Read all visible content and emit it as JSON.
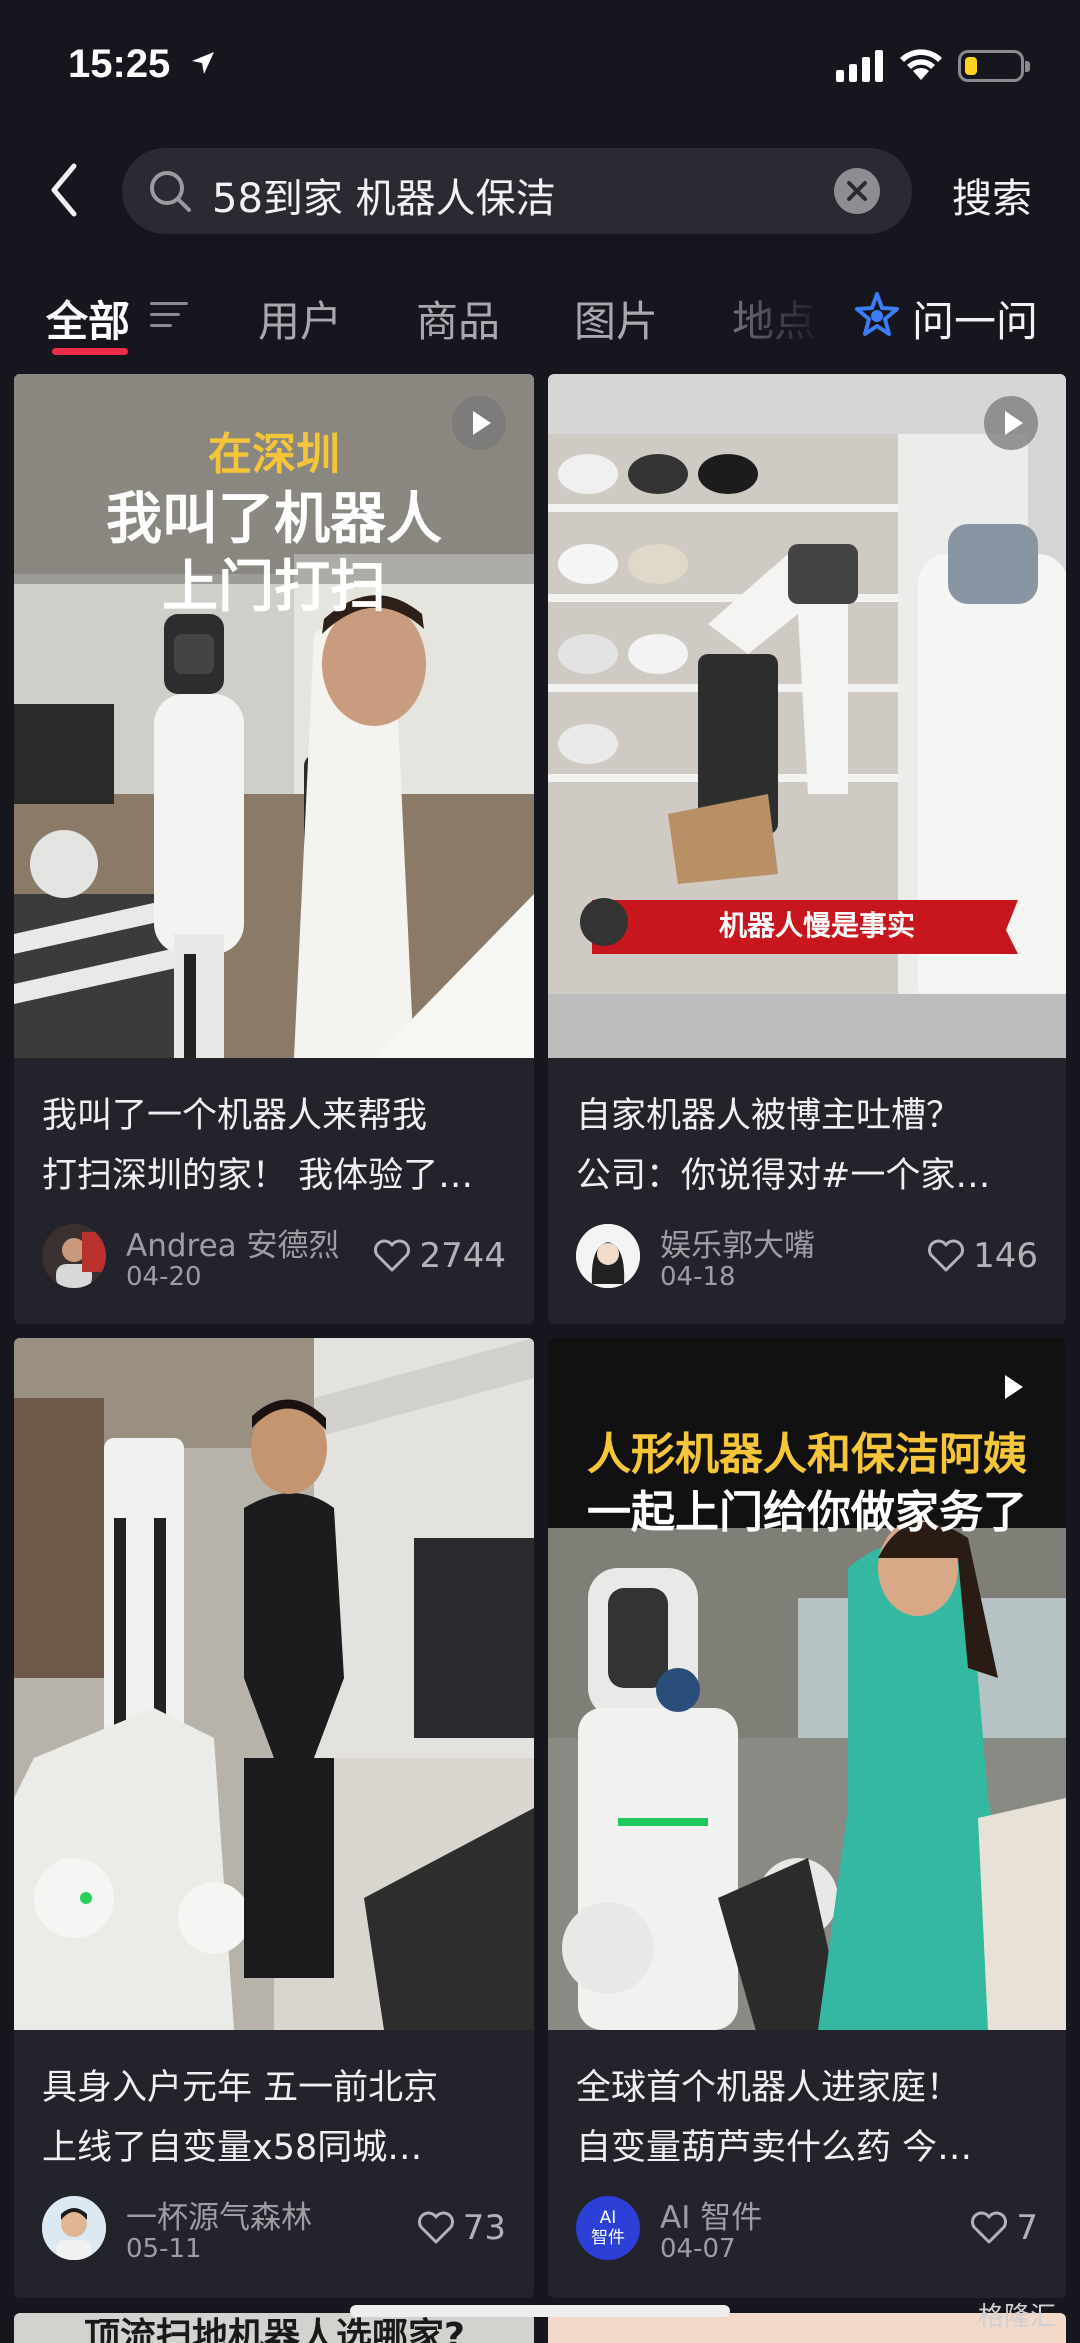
{
  "status": {
    "time": "15:25"
  },
  "search": {
    "query": "58到家 机器人保洁",
    "button": "搜索"
  },
  "tabs": [
    {
      "label": "全部",
      "active": true
    },
    {
      "label": "用户"
    },
    {
      "label": "商品"
    },
    {
      "label": "图片"
    },
    {
      "label": "地点"
    }
  ],
  "ask": {
    "label": "问一问"
  },
  "cards": [
    {
      "overlay_top": "在深圳",
      "overlay_main_1": "我叫了机器人",
      "overlay_main_2": "上门打扫",
      "title_1": "我叫了一个机器人来帮我",
      "title_2": "打扫深圳的家！ 我体验了…",
      "author": "Andrea 安德烈",
      "date": "04-20",
      "likes": "2744"
    },
    {
      "banner": "机器人慢是事实",
      "title_1": "自家机器人被博主吐槽？",
      "title_2": "公司：你说得对#一个家…",
      "author": "娱乐郭大嘴",
      "date": "04-18",
      "likes": "146"
    },
    {
      "title_1": "具身入户元年 五一前北京",
      "title_2": "上线了自变量x58同城…",
      "author": "一杯源气森林",
      "date": "05-11",
      "likes": "73"
    },
    {
      "overlay_main_1": "人形机器人和保洁阿姨",
      "overlay_main_2": "一起上门给你做家务了",
      "title_1": "全球首个机器人进家庭！",
      "title_2": "自变量葫芦卖什么药 今…",
      "author": "AI 智件",
      "avatar_text_1": "AI",
      "avatar_text_2": "智件",
      "date": "04-07",
      "likes": "7"
    }
  ],
  "peek": {
    "title": "顶流扫地机器人选哪家?"
  },
  "watermark": "格隆汇",
  "colors": {
    "background": "#16161f",
    "card": "#23232c",
    "accent_underline": "#ef2b4c",
    "ask_icon": "#3d7cf5"
  }
}
